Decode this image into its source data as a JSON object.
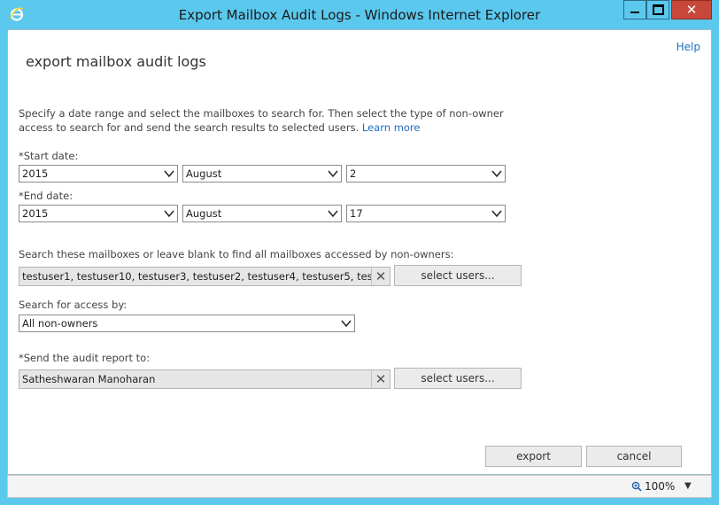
{
  "window": {
    "title": "Export Mailbox Audit Logs - Windows Internet Explorer",
    "icons": {
      "app": "internet-explorer-icon",
      "minimize": "minimize-icon",
      "maximize": "maximize-icon",
      "close": "close-icon"
    }
  },
  "page": {
    "help": "Help",
    "heading": "export mailbox audit logs",
    "description": "Specify a date range and select the mailboxes to search for. Then select the type of non-owner access to search for and send the search results to selected users.",
    "learn_more": "Learn more"
  },
  "start_date": {
    "label": "*Start date:",
    "year": "2015",
    "month": "August",
    "day": "2"
  },
  "end_date": {
    "label": "*End date:",
    "year": "2015",
    "month": "August",
    "day": "17"
  },
  "mailboxes": {
    "label": "Search these mailboxes or leave blank to find all mailboxes accessed by non-owners:",
    "value": "testuser1, testuser10, testuser3, testuser2, testuser4, testuser5, testuser7, te",
    "select_button": "select users..."
  },
  "access": {
    "label": "Search for access by:",
    "value": "All non-owners"
  },
  "report": {
    "label": "*Send the audit report to:",
    "value": "Satheshwaran Manoharan",
    "select_button": "select users..."
  },
  "actions": {
    "export": "export",
    "cancel": "cancel"
  },
  "statusbar": {
    "zoom": "100%"
  }
}
